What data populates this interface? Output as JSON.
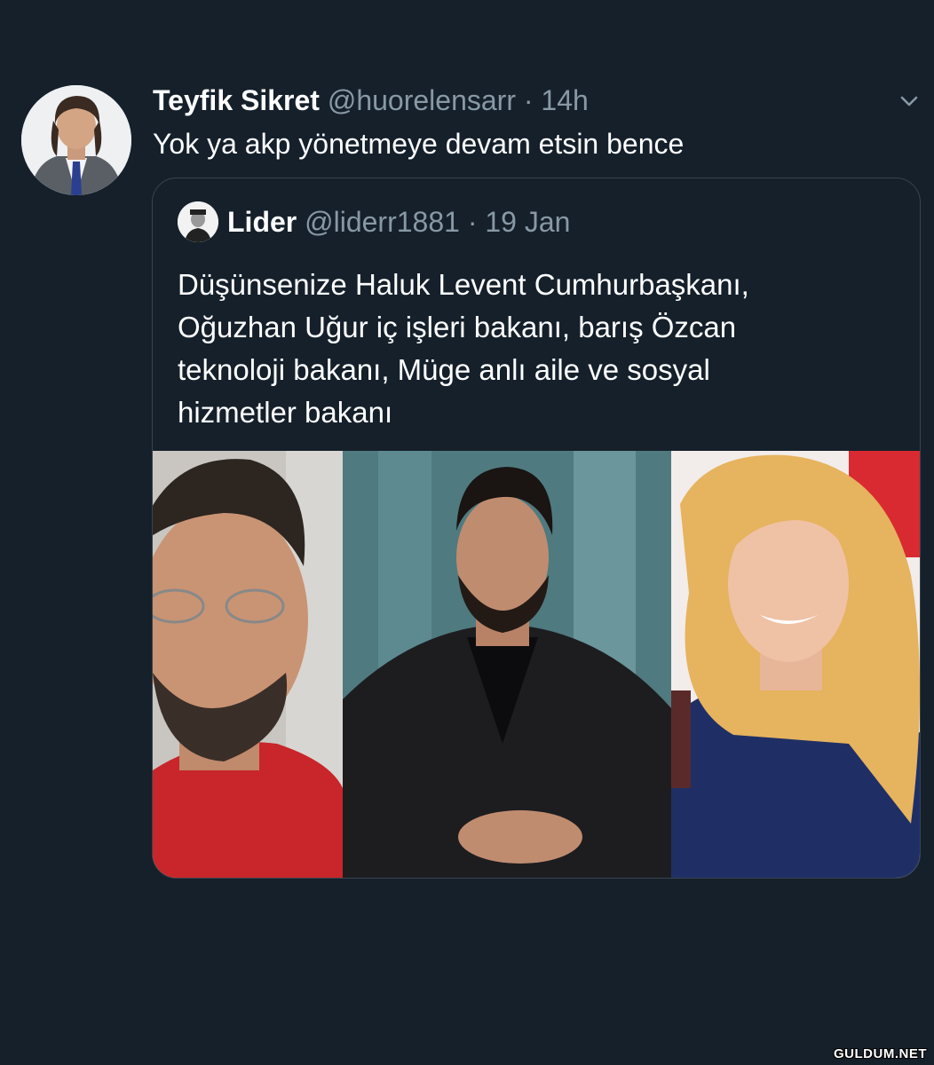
{
  "tweet": {
    "author_name": "Teyfik Sikret",
    "author_handle": "@huorelensarr",
    "separator": "·",
    "time": "14h",
    "text": "Yok ya akp yönetmeye devam etsin bence",
    "avatar_icon": "user-avatar",
    "caret_icon": "chevron-down-icon"
  },
  "quoted_tweet": {
    "author_name": "Lider",
    "author_handle": "@liderr1881",
    "separator": "·",
    "date": "19 Jan",
    "text_lines": [
      "Düşünsenize Haluk Levent Cumhurbaşkanı,",
      "Oğuzhan Uğur iç işleri bakanı, barış Özcan",
      "teknoloji bakanı, Müge anlı aile ve sosyal",
      "hizmetler bakanı"
    ],
    "media": [
      {
        "icon": "man-with-glasses-photo"
      },
      {
        "icon": "man-with-beard-photo"
      },
      {
        "icon": "blonde-woman-photo"
      }
    ]
  },
  "watermark": "GULDUM.NET",
  "colors": {
    "background": "#15202b",
    "border": "#38444d",
    "secondary_text": "#8899a6",
    "primary_text": "#ffffff"
  }
}
